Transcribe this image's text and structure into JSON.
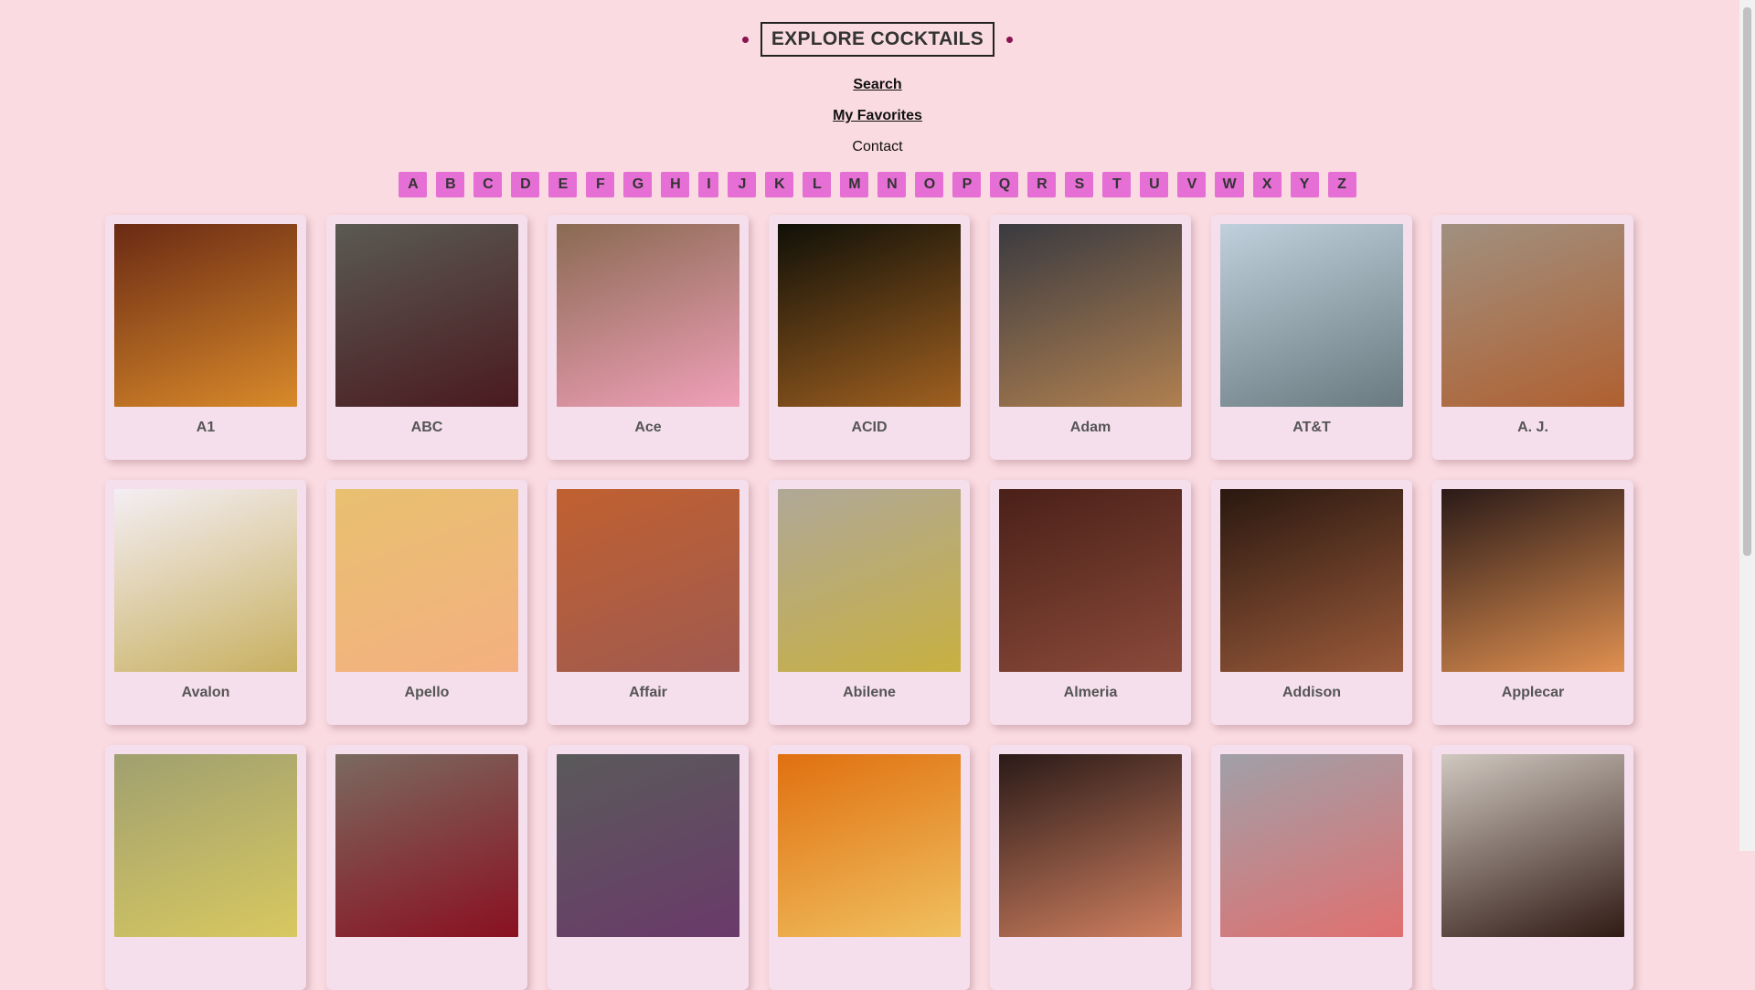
{
  "header": {
    "title": "EXPLORE COCKTAILS",
    "links": {
      "search": "Search",
      "favorites": "My Favorites",
      "contact": "Contact"
    }
  },
  "letters": [
    "A",
    "B",
    "C",
    "D",
    "E",
    "F",
    "G",
    "H",
    "I",
    "J",
    "K",
    "L",
    "M",
    "N",
    "O",
    "P",
    "Q",
    "R",
    "S",
    "T",
    "U",
    "V",
    "W",
    "X",
    "Y",
    "Z"
  ],
  "colors": {
    "background": "#fadbe1",
    "card": "#f5dfec",
    "letter_button": "#e56fd4",
    "accent_dot": "#8a1450"
  },
  "cocktails": [
    {
      "name": "A1",
      "bg": [
        "#6a2a14",
        "#d98a2a"
      ]
    },
    {
      "name": "ABC",
      "bg": [
        "#5a5a52",
        "#4a1a20"
      ]
    },
    {
      "name": "Ace",
      "bg": [
        "#8a6a52",
        "#f0a0b8"
      ]
    },
    {
      "name": "ACID",
      "bg": [
        "#101008",
        "#a06020"
      ]
    },
    {
      "name": "Adam",
      "bg": [
        "#3a3a40",
        "#b08050"
      ]
    },
    {
      "name": "AT&T",
      "bg": [
        "#c0d0dc",
        "#6a7a80"
      ]
    },
    {
      "name": "A. J.",
      "bg": [
        "#a09080",
        "#b06030"
      ]
    },
    {
      "name": "Avalon",
      "bg": [
        "#f4eef4",
        "#c8b060"
      ]
    },
    {
      "name": "Apello",
      "bg": [
        "#e8c070",
        "#f4b080"
      ]
    },
    {
      "name": "Affair",
      "bg": [
        "#c06030",
        "#a05a50"
      ]
    },
    {
      "name": "Abilene",
      "bg": [
        "#b0a898",
        "#c8b040"
      ]
    },
    {
      "name": "Almeria",
      "bg": [
        "#4a2018",
        "#8a4a3a"
      ]
    },
    {
      "name": "Addison",
      "bg": [
        "#2a1810",
        "#9a5a3a"
      ]
    },
    {
      "name": "Applecar",
      "bg": [
        "#2a1a18",
        "#e09050"
      ]
    },
    {
      "name": "",
      "bg": [
        "#a0a070",
        "#d8c860"
      ]
    },
    {
      "name": "",
      "bg": [
        "#7a6a60",
        "#8a1020"
      ]
    },
    {
      "name": "",
      "bg": [
        "#5a5a5a",
        "#6a3a6a"
      ]
    },
    {
      "name": "",
      "bg": [
        "#e07010",
        "#f0c060"
      ]
    },
    {
      "name": "",
      "bg": [
        "#2a1a18",
        "#d08060"
      ]
    },
    {
      "name": "",
      "bg": [
        "#a0a0a8",
        "#e07070"
      ]
    },
    {
      "name": "",
      "bg": [
        "#d0c8c0",
        "#301a14"
      ]
    }
  ]
}
